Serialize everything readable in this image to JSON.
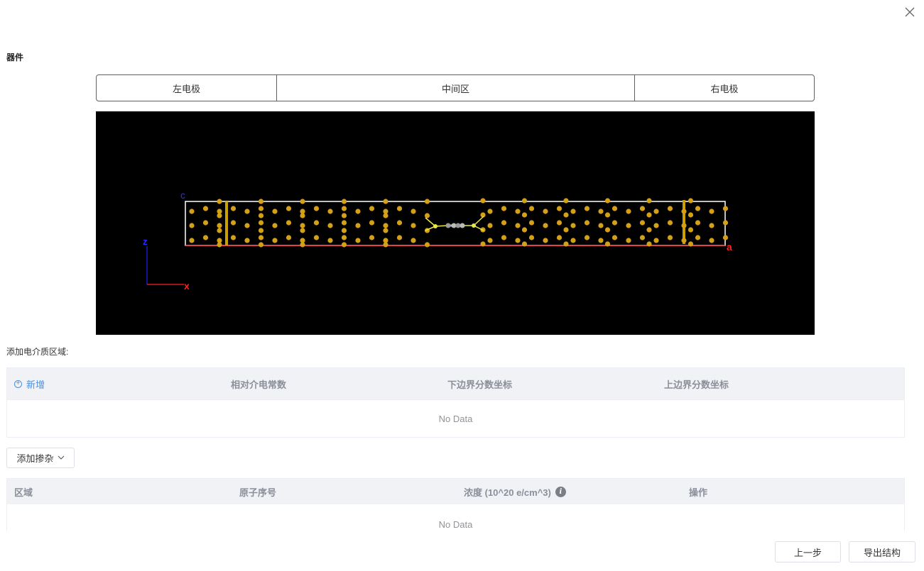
{
  "header": {
    "title": "器件",
    "close_icon": "close-icon"
  },
  "regions": {
    "left": "左电极",
    "middle": "中间区",
    "right": "右电极"
  },
  "viewer": {
    "axis_labels": {
      "c": "c",
      "a": "a",
      "z": "z",
      "x": "x"
    },
    "colors": {
      "atom": "#d4a017",
      "bond": "#e8e84a",
      "carbon": "#aaaaaa",
      "cell": "#ffffff",
      "axis_x": "#ff0000",
      "axis_z": "#0000ff"
    }
  },
  "dielectric": {
    "label": "添加电介质区域:",
    "add_label": "新增",
    "columns": [
      "相对介电常数",
      "下边界分数坐标",
      "上边界分数坐标"
    ],
    "empty_text": "No Data"
  },
  "doping": {
    "button_label": "添加掺杂",
    "columns": [
      "区域",
      "原子序号",
      "浓度 (10^20 e/cm^3)",
      "操作"
    ],
    "info_icon": "i",
    "empty_text": "No Data"
  },
  "footer": {
    "prev_label": "上一步",
    "export_label": "导出结构"
  }
}
